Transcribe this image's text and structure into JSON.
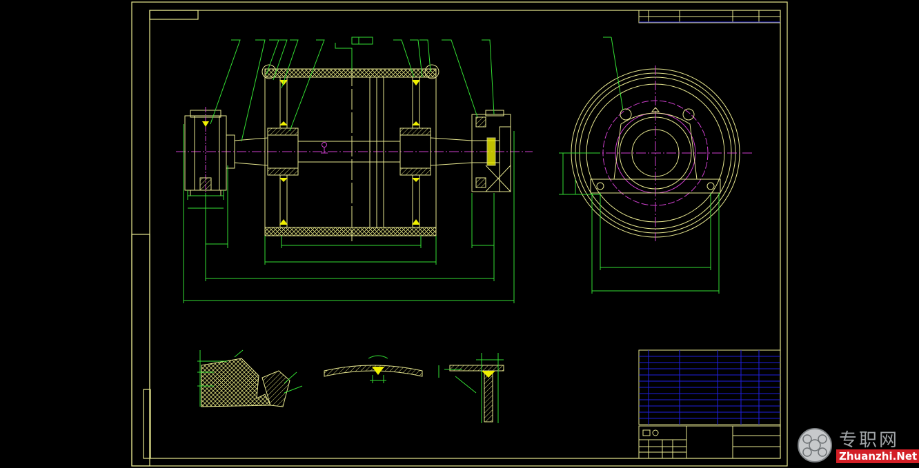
{
  "colors": {
    "frame": "#e8e890",
    "dimension": "#33e033",
    "centerline": "#d040d0",
    "hatch": "#d8d87a",
    "weld": "#f0f000",
    "titleblock_grid": "#2020e0",
    "watermark_red": "#d31f26",
    "watermark_gray": "#9fa3a6"
  },
  "views": [
    {
      "name": "front-section-view",
      "label": ""
    },
    {
      "name": "side-end-view",
      "label": ""
    },
    {
      "name": "detail-hatched-lining",
      "label": ""
    },
    {
      "name": "detail-weld-curved",
      "label": ""
    },
    {
      "name": "detail-weld-tee",
      "label": ""
    }
  ],
  "title_block": {
    "rows": 12,
    "cols": 8
  },
  "watermark": {
    "cn": "专职网",
    "en": "Zhuanzhi.Net",
    "icon": "globe-icon"
  }
}
